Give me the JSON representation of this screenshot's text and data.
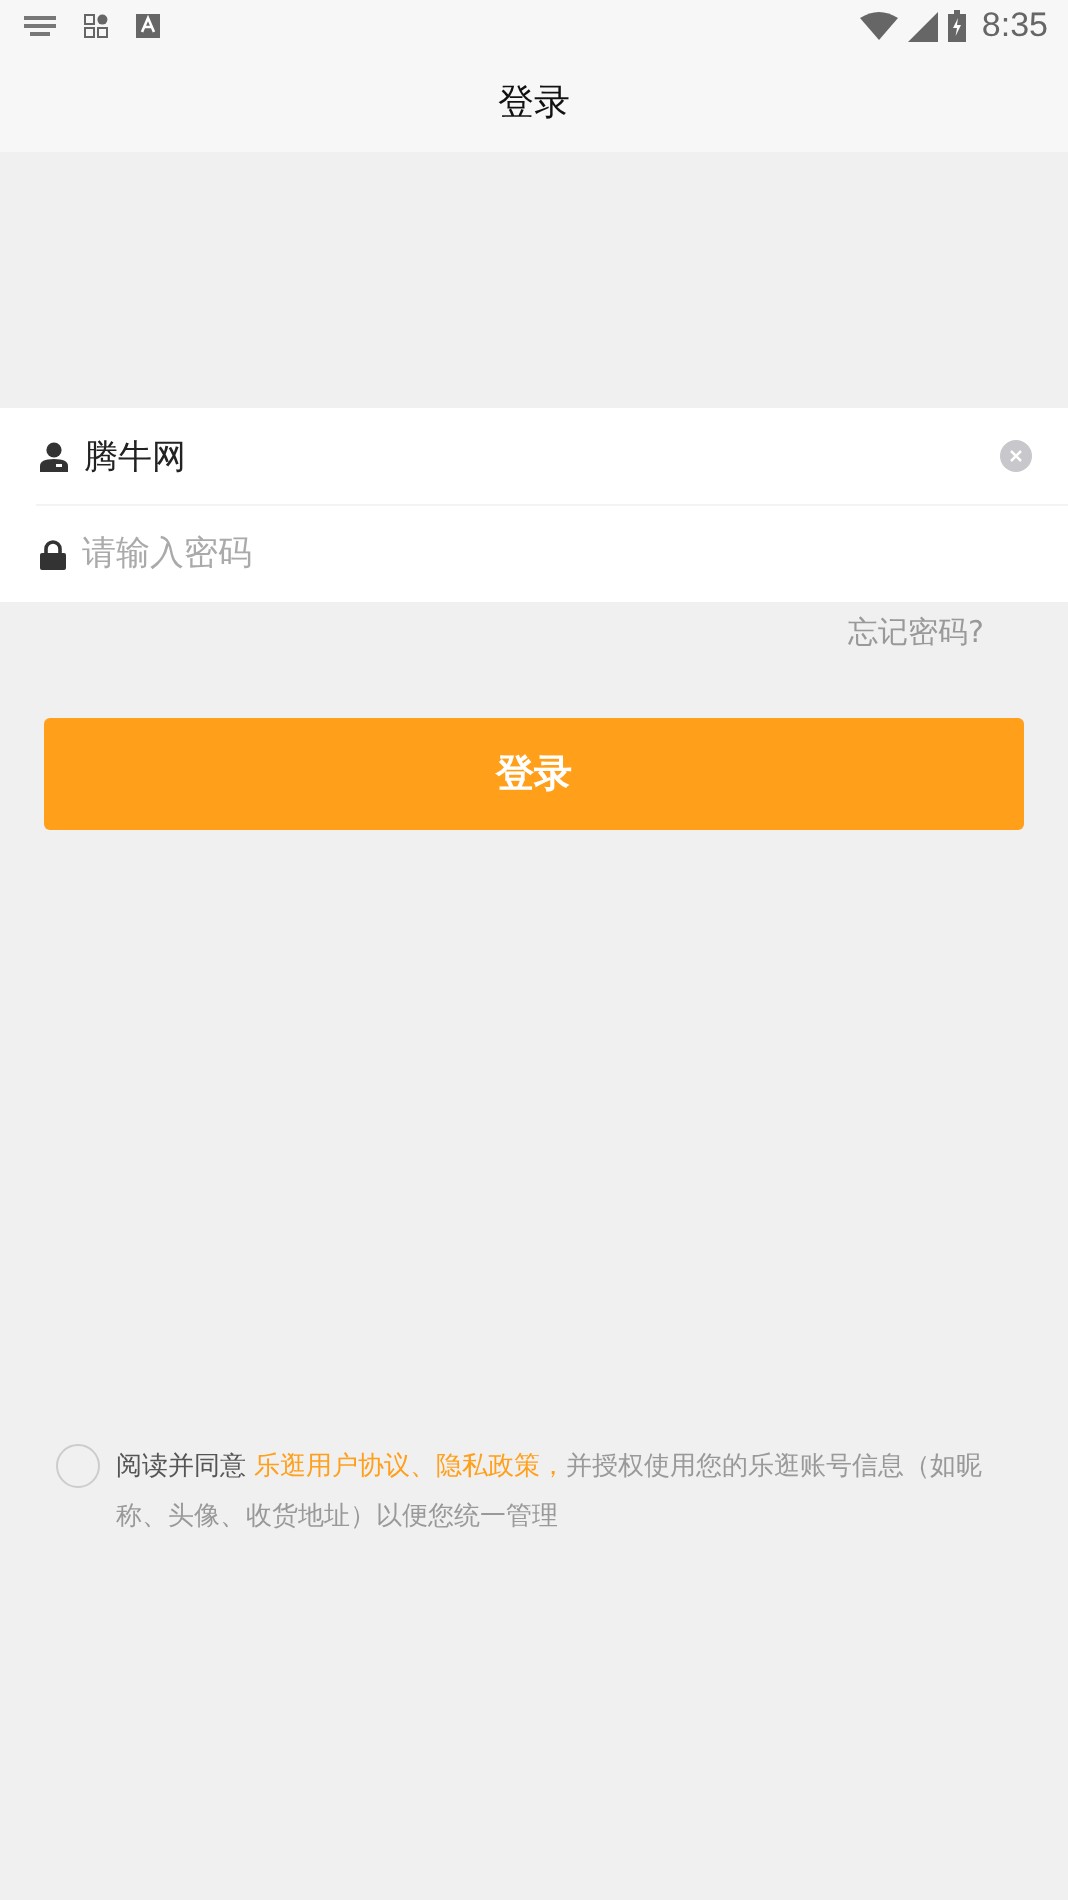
{
  "status_bar": {
    "time": "8:35"
  },
  "header": {
    "title": "登录"
  },
  "username": {
    "value": "腾牛网"
  },
  "password": {
    "placeholder": "请输入密码"
  },
  "forgot_link": "忘记密码?",
  "login_button": "登录",
  "agreement": {
    "checked": false,
    "parts": [
      {
        "kind": "lead",
        "text": "阅读并同意 "
      },
      {
        "kind": "link",
        "text": "乐逛用户协议、隐私政策，"
      },
      {
        "kind": "plain",
        "text": "并授权使用您的乐逛账号信息（如昵称、头像、收货地址）以便您统一管理"
      }
    ]
  }
}
